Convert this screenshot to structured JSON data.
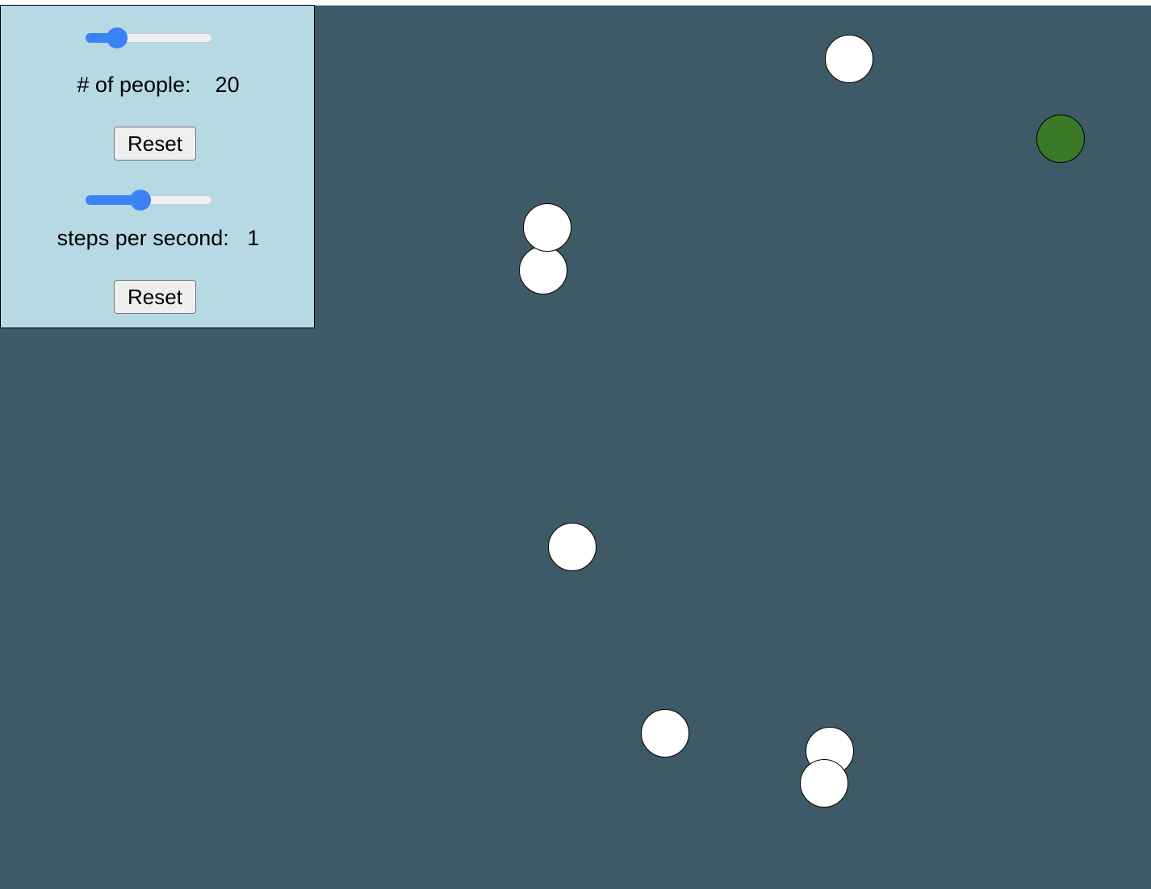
{
  "controls": {
    "people_slider": {
      "fraction": 0.14
    },
    "people_label": "# of people:",
    "people_value": "20",
    "reset_people_label": "Reset",
    "speed_slider": {
      "fraction": 0.36
    },
    "speed_label": "steps per second:",
    "speed_value": "1",
    "reset_speed_label": "Reset"
  },
  "colors": {
    "stage_background": "#3e5a66",
    "panel_background": "#b7d9e4",
    "slider_accent": "#3b82f6",
    "healthy_person": "#ffffff",
    "infected_person": "#3a7a26"
  }
}
